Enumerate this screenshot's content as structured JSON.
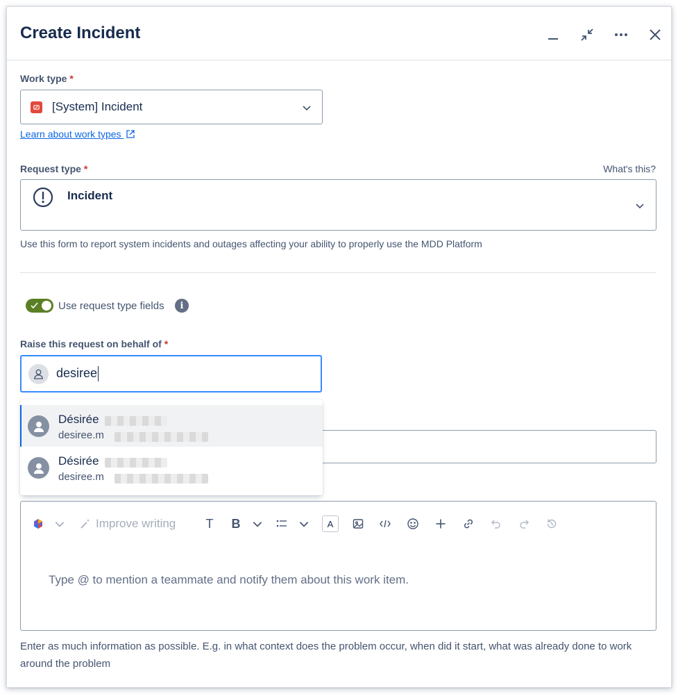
{
  "header": {
    "title": "Create Incident"
  },
  "work_type": {
    "label": "Work type",
    "required_mark": "*",
    "value": "[System] Incident",
    "link": "Learn about work types"
  },
  "request_type": {
    "label": "Request type",
    "required_mark": "*",
    "whats_this": "What's this?",
    "value": "Incident",
    "help": "Use this form to report system incidents and outages affecting your ability to properly use the MDD Platform"
  },
  "toggle": {
    "label": "Use request type fields",
    "checked": true
  },
  "raise_on_behalf": {
    "label": "Raise this request on behalf of",
    "required_mark": "*",
    "value": "desiree"
  },
  "dropdown": {
    "options": [
      {
        "name": "Désirée",
        "email": "desiree.m"
      },
      {
        "name": "Désirée",
        "email": "desiree.m"
      }
    ]
  },
  "editor": {
    "improve_writing": "Improve writing",
    "placeholder": "Type @ to mention a teammate and notify them about this work item."
  },
  "description_help": "Enter as much information as possible. E.g. in what context does the problem occur, when did it start, what was already done to work around the problem",
  "colors": {
    "accent": "#0c66e4",
    "toggle_on": "#5b7f24",
    "required": "#c9372c",
    "incident_icon": "#e2483d"
  }
}
